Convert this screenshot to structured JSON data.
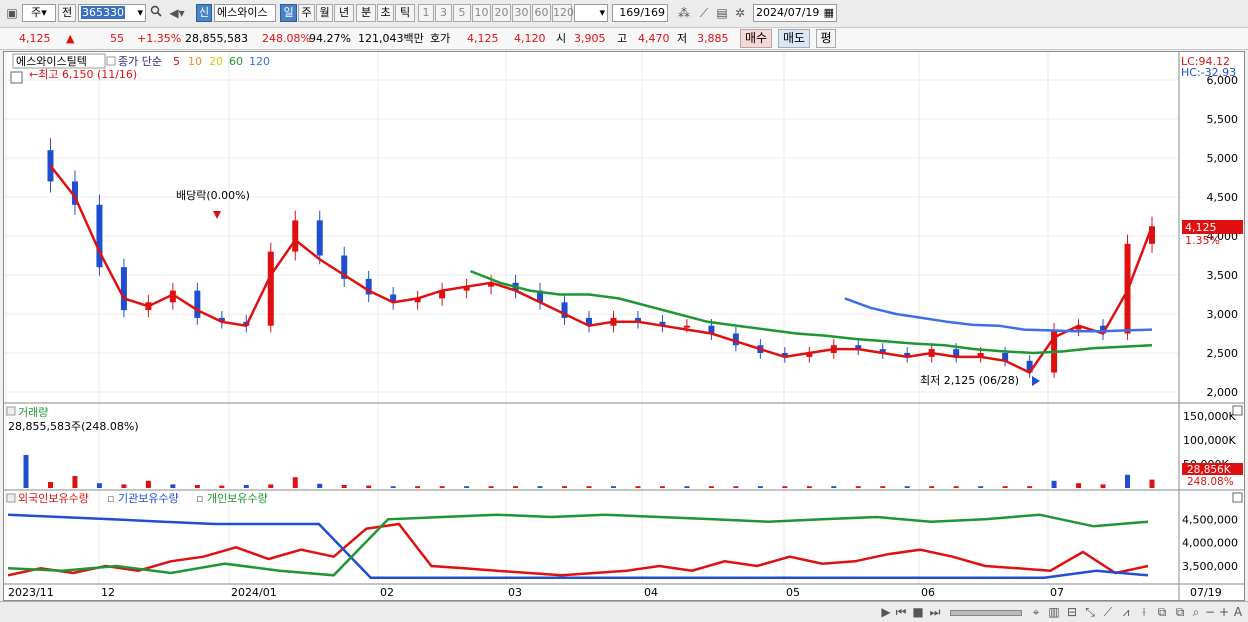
{
  "toolbar": {
    "period_label": "주",
    "prev_label": "전",
    "stock_code": "365330",
    "market_badge": "신",
    "stock_name": "에스와이스",
    "periods": [
      "일",
      "주",
      "월",
      "년",
      "분",
      "초",
      "틱"
    ],
    "intervals": [
      "1",
      "3",
      "5",
      "10",
      "20",
      "30",
      "60",
      "120"
    ],
    "count": "169",
    "count_total": "/169",
    "date": "2024/07/19"
  },
  "quote": {
    "price": "4,125",
    "arrow": "▲",
    "change": "55",
    "change_pct": "+1.35%",
    "volume": "28,855,583",
    "volume_ratio": "248.08%",
    "ratio2": "94.27%",
    "amount": "121,043백만",
    "hoga_label": "호가",
    "ask": "4,125",
    "bid": "4,120",
    "open_label": "시",
    "open": "3,905",
    "high_label": "고",
    "high": "4,470",
    "low_label": "저",
    "low": "3,885",
    "buy_label": "매수",
    "sell_label": "매도",
    "avg_label": "평"
  },
  "legend": {
    "stock_name": "에스와이스틸텍",
    "ma_title": "종가 단순",
    "ma5": "5",
    "ma10": "10",
    "ma20": "20",
    "ma60": "60",
    "ma120": "120",
    "high_note": "최고 6,150 (11/16)",
    "low_note": "최저 2,125 (06/28)",
    "dividend_note": "배당락(0.00%)",
    "lc": "LC:94.12",
    "hc": "HC:-32.93",
    "last_price": "4,125",
    "last_pct": "1.35%"
  },
  "volume_panel": {
    "title": "거래량",
    "current": "28,855,583주(248.08%)",
    "last_value": "28,856K",
    "last_pct": "248.08%"
  },
  "holders_panel": {
    "foreign": "외국인보유수량",
    "institution": "기관보유수량",
    "individual": "개인보유수량"
  },
  "colors": {
    "up": "#e01010",
    "down": "#1f4fd0",
    "ma5": "#e01010",
    "ma10": "#f08c1e",
    "ma20": "#f0e61e",
    "ma60": "#1e9632",
    "ma120": "#3c6ee6"
  },
  "chart_data": [
    {
      "type": "line",
      "title": "에스와이스틸텍",
      "ylim": [
        2000,
        6000
      ],
      "y_ticks": [
        "6,000",
        "5,500",
        "5,000",
        "4,500",
        "4,000",
        "3,500",
        "3,000",
        "2,500",
        "2,000"
      ],
      "x_ticks": [
        "2023/11",
        "12",
        "2024/01",
        "02",
        "03",
        "04",
        "05",
        "06",
        "07",
        "07/19"
      ],
      "series": [
        {
          "name": "종가 (approx.)",
          "values": [
            5100,
            4700,
            4400,
            3600,
            3050,
            3150,
            3300,
            2950,
            2900,
            2850,
            3800,
            4200,
            3750,
            3450,
            3250,
            3150,
            3200,
            3300,
            3350,
            3400,
            3300,
            3150,
            2950,
            2850,
            2950,
            2900,
            2850,
            2850,
            2750,
            2600,
            2500,
            2450,
            2500,
            2600,
            2550,
            2500,
            2450,
            2550,
            2450,
            2500,
            2400,
            2250,
            2800,
            2850,
            2750,
            3900,
            4125
          ]
        },
        {
          "name": "5",
          "values": [
            null,
            4900,
            4500,
            3800,
            3200,
            3100,
            3250,
            3050,
            2900,
            2850,
            3500,
            3950,
            3700,
            3500,
            3300,
            3150,
            3200,
            3300,
            3350,
            3400,
            3300,
            3150,
            3000,
            2850,
            2900,
            2900,
            2850,
            2800,
            2750,
            2650,
            2550,
            2450,
            2500,
            2550,
            2550,
            2500,
            2450,
            2500,
            2450,
            2450,
            2400,
            2250,
            2700,
            2850,
            2750,
            3300,
            4125
          ]
        },
        {
          "name": "60",
          "values": [
            null,
            null,
            null,
            null,
            null,
            null,
            null,
            null,
            null,
            null,
            null,
            null,
            null,
            null,
            null,
            3550,
            3400,
            3300,
            3250,
            3250,
            3200,
            3100,
            3000,
            2900,
            2850,
            2800,
            2750,
            2720,
            2680,
            2650,
            2620,
            2600,
            2550,
            2520,
            2500,
            2520,
            2560,
            2580,
            2600
          ]
        },
        {
          "name": "120",
          "values": [
            null,
            null,
            null,
            null,
            null,
            null,
            null,
            null,
            null,
            null,
            null,
            null,
            null,
            null,
            null,
            null,
            null,
            null,
            null,
            null,
            null,
            null,
            null,
            null,
            null,
            null,
            null,
            null,
            null,
            null,
            null,
            null,
            3200,
            3080,
            3000,
            2950,
            2900,
            2860,
            2850,
            2800,
            2790,
            2780,
            2780,
            2790,
            2800
          ]
        }
      ]
    },
    {
      "type": "line",
      "title": "외국인보유수량 / 기관보유수량 / 개인보유수량",
      "y_ticks": [
        "4,500,000",
        "4,000,000",
        "3,500,000"
      ],
      "series": [
        {
          "name": "외국인보유수량",
          "values": [
            3300000,
            3450000,
            3350000,
            3500000,
            3400000,
            3600000,
            3700000,
            3900000,
            3650000,
            3850000,
            3700000,
            4300000,
            4400000,
            3500000,
            3450000,
            3400000,
            3350000,
            3300000,
            3350000,
            3400000,
            3500000,
            3400000,
            3600000,
            3500000,
            3700000,
            3550000,
            3600000,
            3750000,
            3850000,
            3700000,
            3500000,
            3450000,
            3400000,
            3800000,
            3350000,
            3500000
          ]
        },
        {
          "name": "기관보유수량",
          "values": [
            4600000,
            4550000,
            4500000,
            4450000,
            4400000,
            4400000,
            4400000,
            3250000,
            3250000,
            3250000,
            3250000,
            3250000,
            3250000,
            3250000,
            3250000,
            3250000,
            3250000,
            3250000,
            3250000,
            3250000,
            3250000,
            3400000,
            3300000
          ]
        },
        {
          "name": "개인보유수량",
          "values": [
            3450000,
            3400000,
            3500000,
            3350000,
            3550000,
            3400000,
            3300000,
            4500000,
            4550000,
            4600000,
            4550000,
            4600000,
            4550000,
            4500000,
            4450000,
            4500000,
            4550000,
            4450000,
            4500000,
            4600000,
            4350000,
            4450000
          ]
        }
      ]
    }
  ]
}
